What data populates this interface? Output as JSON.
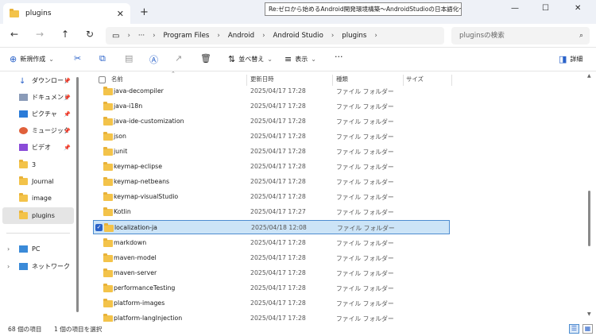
{
  "window": {
    "tab_title": "plugins",
    "tab_close": "✕",
    "new_tab": "+",
    "tooltip": "Re:ゼロから始めるAndroid開発環境構築〜AndroidStudioの日本語化〜",
    "minimize": "—",
    "maximize": "☐",
    "close": "✕"
  },
  "nav": {
    "back": "←",
    "forward": "→",
    "up": "↑",
    "refresh": "↻",
    "more": "···",
    "breadcrumbs": [
      "Program Files",
      "Android",
      "Android Studio",
      "plugins"
    ],
    "search_placeholder": "pluginsの検索"
  },
  "commands": {
    "new_label": "新規作成",
    "sort_label": "並べ替え",
    "view_label": "表示",
    "more": "···",
    "details_label": "詳細"
  },
  "sidebar": {
    "quick_access": [
      {
        "label": "ダウンロード",
        "icon": "download-icon",
        "pinned": true
      },
      {
        "label": "ドキュメント",
        "icon": "documents-icon",
        "pinned": true
      },
      {
        "label": "ピクチャ",
        "icon": "pictures-icon",
        "pinned": true
      },
      {
        "label": "ミュージック",
        "icon": "music-icon",
        "pinned": true
      },
      {
        "label": "ビデオ",
        "icon": "videos-icon",
        "pinned": true
      },
      {
        "label": "3",
        "icon": "folder-icon",
        "pinned": false
      },
      {
        "label": "Journal",
        "icon": "folder-icon",
        "pinned": false
      },
      {
        "label": "image",
        "icon": "folder-icon",
        "pinned": false
      },
      {
        "label": "plugins",
        "icon": "folder-icon",
        "pinned": false
      }
    ],
    "pc_label": "PC",
    "network_label": "ネットワーク"
  },
  "list": {
    "columns": {
      "name": "名前",
      "date": "更新日時",
      "type": "種類",
      "size": "サイズ"
    },
    "rows": [
      {
        "name": "java-decompiler",
        "date": "2025/04/17 17:28",
        "type": "ファイル フォルダー"
      },
      {
        "name": "java-i18n",
        "date": "2025/04/17 17:28",
        "type": "ファイル フォルダー"
      },
      {
        "name": "java-ide-customization",
        "date": "2025/04/17 17:28",
        "type": "ファイル フォルダー"
      },
      {
        "name": "json",
        "date": "2025/04/17 17:28",
        "type": "ファイル フォルダー"
      },
      {
        "name": "junit",
        "date": "2025/04/17 17:28",
        "type": "ファイル フォルダー"
      },
      {
        "name": "keymap-eclipse",
        "date": "2025/04/17 17:28",
        "type": "ファイル フォルダー"
      },
      {
        "name": "keymap-netbeans",
        "date": "2025/04/17 17:28",
        "type": "ファイル フォルダー"
      },
      {
        "name": "keymap-visualStudio",
        "date": "2025/04/17 17:28",
        "type": "ファイル フォルダー"
      },
      {
        "name": "Kotlin",
        "date": "2025/04/17 17:27",
        "type": "ファイル フォルダー"
      },
      {
        "name": "localization-ja",
        "date": "2025/04/18 12:08",
        "type": "ファイル フォルダー",
        "selected": true
      },
      {
        "name": "markdown",
        "date": "2025/04/17 17:28",
        "type": "ファイル フォルダー"
      },
      {
        "name": "maven-model",
        "date": "2025/04/17 17:28",
        "type": "ファイル フォルダー"
      },
      {
        "name": "maven-server",
        "date": "2025/04/17 17:28",
        "type": "ファイル フォルダー"
      },
      {
        "name": "performanceTesting",
        "date": "2025/04/17 17:28",
        "type": "ファイル フォルダー"
      },
      {
        "name": "platform-images",
        "date": "2025/04/17 17:28",
        "type": "ファイル フォルダー"
      },
      {
        "name": "platform-langInjection",
        "date": "2025/04/17 17:28",
        "type": "ファイル フォルダー"
      }
    ]
  },
  "status": {
    "item_count": "68 個の項目",
    "selected_count": "1 個の項目を選択"
  },
  "colors": {
    "accent": "#2a62c9",
    "selection": "#cce4f7",
    "folder": "#f3c34a"
  }
}
